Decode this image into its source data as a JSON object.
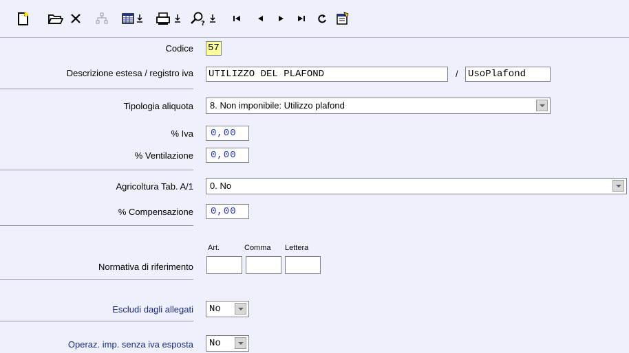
{
  "toolbar": {
    "icons": [
      "new-document-icon",
      "open-folder-icon",
      "delete-icon",
      "hierarchy-icon",
      "table-view-icon",
      "print-icon",
      "search-help-icon",
      "first-record-icon",
      "previous-record-icon",
      "next-record-icon",
      "last-record-icon",
      "refresh-icon",
      "properties-icon"
    ]
  },
  "form": {
    "codice_label": "Codice",
    "codice_value": "57",
    "descrizione_label": "Descrizione estesa / registro iva",
    "descrizione_value": "UTILIZZO DEL PLAFOND",
    "slash": "/",
    "registro_value": "UsoPlafond",
    "tipologia_label": "Tipologia aliquota",
    "tipologia_value": "8. Non imponibile: Utilizzo plafond",
    "iva_label": "% Iva",
    "iva_value": "0,00",
    "ventilazione_label": "% Ventilazione",
    "ventilazione_value": "0,00",
    "agricoltura_label": "Agricoltura Tab. A/1",
    "agricoltura_value": "0. No",
    "compensazione_label": "% Compensazione",
    "compensazione_value": "0,00",
    "normativa_label": "Normativa di riferimento",
    "art_label": "Art.",
    "comma_label": "Comma",
    "lettera_label": "Lettera",
    "art_value": "",
    "comma_value": "",
    "lettera_value": "",
    "escludi_label": "Escludi dagli allegati",
    "escludi_value": "No",
    "operaz_label": "Operaz. imp. senza iva esposta",
    "operaz_value": "No"
  }
}
